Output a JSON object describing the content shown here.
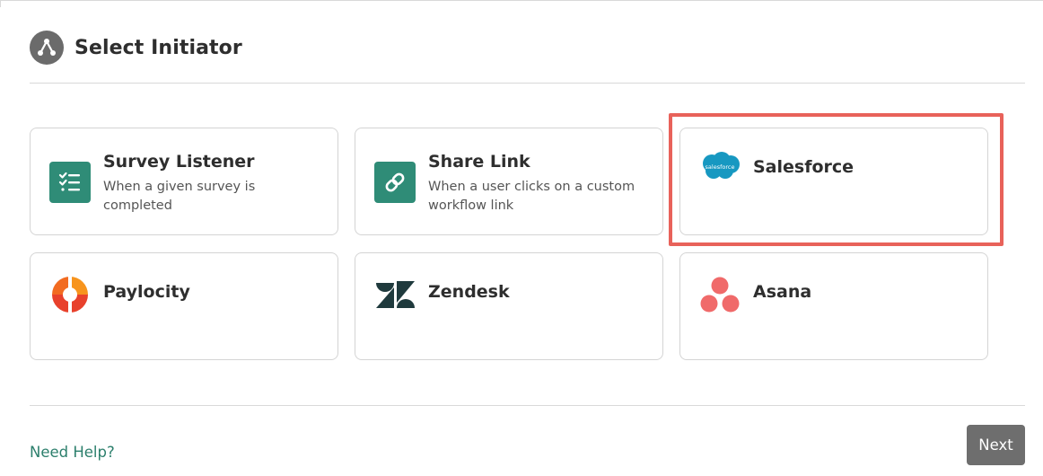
{
  "header": {
    "title": "Select Initiator",
    "icon": "workflow-icon"
  },
  "initiators": [
    {
      "title": "Survey Listener",
      "description": "When a given survey is completed",
      "icon": "checklist-icon",
      "selected": false
    },
    {
      "title": "Share Link",
      "description": "When a user clicks on a custom workflow link",
      "icon": "link-icon",
      "selected": false
    },
    {
      "title": "Salesforce",
      "description": "",
      "icon": "salesforce-logo",
      "logo_text": "salesforce",
      "selected": true
    },
    {
      "title": "Paylocity",
      "description": "",
      "icon": "paylocity-logo",
      "selected": false
    },
    {
      "title": "Zendesk",
      "description": "",
      "icon": "zendesk-logo",
      "selected": false
    },
    {
      "title": "Asana",
      "description": "",
      "icon": "asana-logo",
      "selected": false
    }
  ],
  "footer": {
    "help_label": "Need Help?",
    "next_label": "Next"
  },
  "colors": {
    "accent_green": "#2f8c77",
    "link_green": "#2c7f6c",
    "highlight_red": "#e8625a",
    "button_gray": "#6e6e6e",
    "salesforce_blue": "#1798c1",
    "paylocity_orange": "#f26b21",
    "asana_coral": "#f06a6a",
    "zendesk_dark": "#03363d"
  }
}
